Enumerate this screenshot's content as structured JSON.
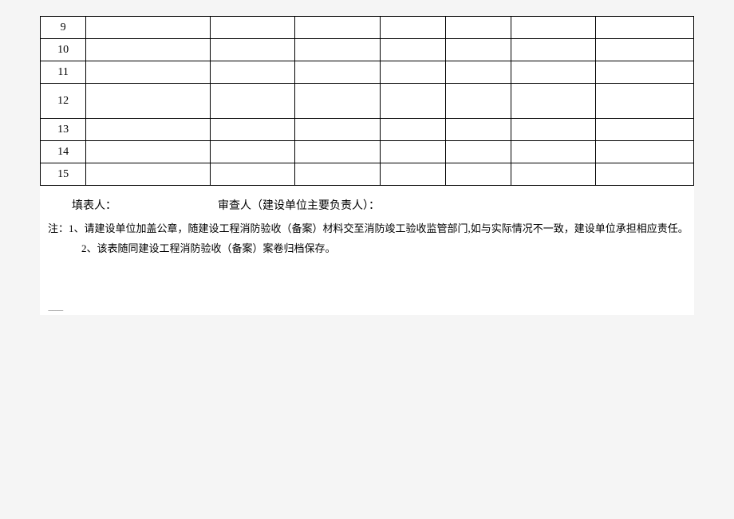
{
  "rows": [
    {
      "num": "9",
      "tall": false
    },
    {
      "num": "10",
      "tall": false
    },
    {
      "num": "11",
      "tall": false
    },
    {
      "num": "12",
      "tall": true
    },
    {
      "num": "13",
      "tall": false
    },
    {
      "num": "14",
      "tall": false
    },
    {
      "num": "15",
      "tall": false
    }
  ],
  "signature": {
    "filler_label": "填表人：",
    "reviewer_label": "审查人（建设单位主要负责人）："
  },
  "notes": {
    "prefix": "注：",
    "item1": "1、请建设单位加盖公章，随建设工程消防验收（备案）材料交至消防竣工验收监管部门,如与实际情况不一致，建设单位承担相应责任。",
    "item2": "2、该表随同建设工程消防验收（备案）案卷归档保存。"
  },
  "dash": "--------"
}
